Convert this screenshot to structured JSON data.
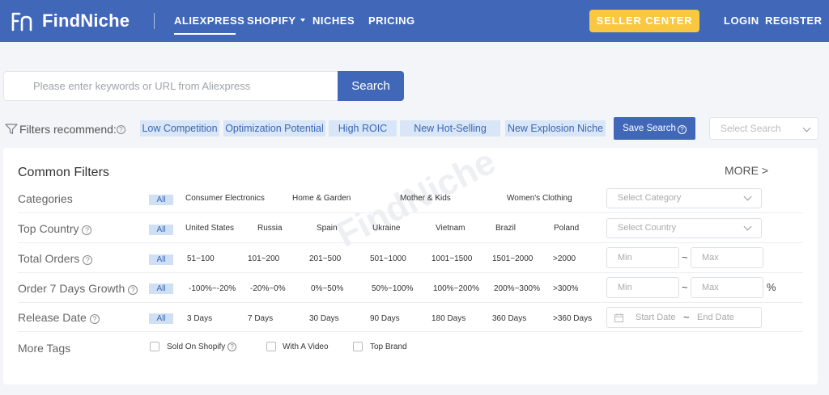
{
  "header": {
    "logo_text": "FindNiche",
    "nav": [
      {
        "label": "ALIEXPRESS"
      },
      {
        "label": "SHOPIFY"
      },
      {
        "label": "NICHES"
      },
      {
        "label": "PRICING"
      }
    ],
    "seller_center": "SELLER CENTER",
    "login": "LOGIN",
    "register": "REGISTER"
  },
  "search": {
    "placeholder": "Please enter keywords or URL from Aliexpress",
    "button": "Search"
  },
  "recommend": {
    "label": "Filters recommend:",
    "chips": [
      "Low Competition",
      "Optimization Potential",
      "High ROIC",
      "New Hot-Selling",
      "New Explosion Niche"
    ],
    "save_search": "Save Search",
    "select_search_placeholder": "Select Search"
  },
  "filters": {
    "title": "Common Filters",
    "more": "MORE >",
    "all_label": "All",
    "categories": {
      "label": "Categories",
      "options": [
        "Consumer Electronics",
        "Home & Garden",
        "Mother & Kids",
        "Women's Clothing"
      ],
      "select_placeholder": "Select Category"
    },
    "top_country": {
      "label": "Top Country",
      "options": [
        "United States",
        "Russia",
        "Spain",
        "Ukraine",
        "Vietnam",
        "Brazil",
        "Poland"
      ],
      "select_placeholder": "Select Country"
    },
    "total_orders": {
      "label": "Total Orders",
      "options": [
        "51~100",
        "101~200",
        "201~500",
        "501~1000",
        "1001~1500",
        "1501~2000",
        ">2000"
      ],
      "min_placeholder": "Min",
      "max_placeholder": "Max",
      "separator": "~"
    },
    "order_growth": {
      "label": "Order 7 Days Growth",
      "options": [
        "-100%~-20%",
        "-20%~0%",
        "0%~50%",
        "50%~100%",
        "100%~200%",
        "200%~300%",
        ">300%"
      ],
      "min_placeholder": "Min",
      "max_placeholder": "Max",
      "separator": "~",
      "unit": "%"
    },
    "release_date": {
      "label": "Release Date",
      "options": [
        "3 Days",
        "7 Days",
        "30 Days",
        "90 Days",
        "180 Days",
        "360 Days",
        ">360 Days"
      ],
      "start_placeholder": "Start Date",
      "end_placeholder": "End Date",
      "separator": "~"
    },
    "more_tags": {
      "label": "More Tags",
      "options": [
        "Sold On Shopify",
        "With A Video",
        "Top Brand"
      ]
    }
  },
  "watermark": "FindNiche",
  "colors": {
    "brand": "#4167b9",
    "seller_button": "#f9c740",
    "chip_bg": "#d8e6f7"
  }
}
